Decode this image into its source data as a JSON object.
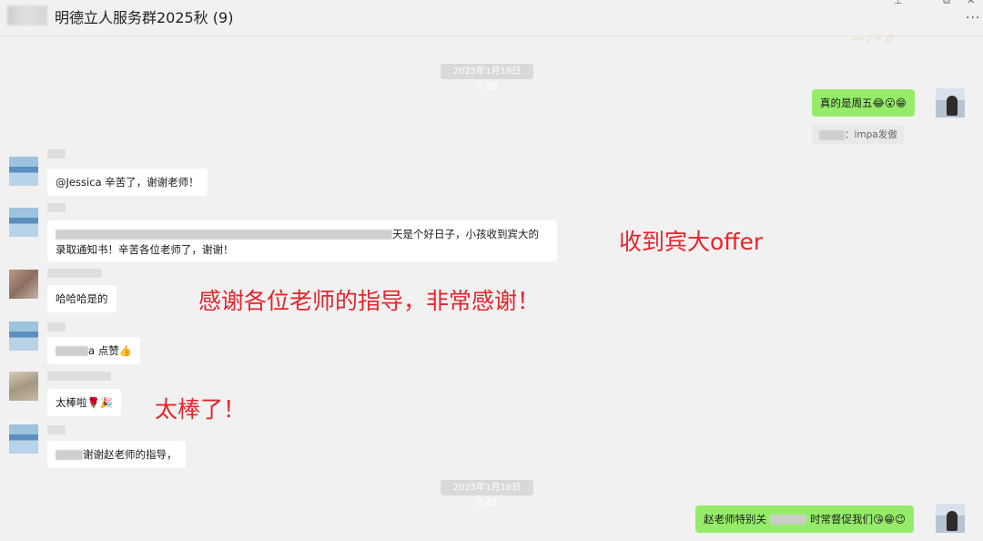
{
  "window": {
    "title": "明德立人服务群2025秋 (9)",
    "pin_icon": "pin-icon",
    "min_icon": "minimize-icon",
    "max_icon": "maximize-icon",
    "close_icon": "close-icon",
    "more_icon": "more-icon"
  },
  "timestamps": [
    "2025年1月18日 7:28",
    "2025年1月18日 7:45"
  ],
  "messages": [
    {
      "side": "right",
      "text": "真的是周五😂😮😁"
    },
    {
      "type": "recall",
      "text": "：impa发傲"
    },
    {
      "side": "left",
      "text": "@Jessica 辛苦了，谢谢老师！"
    },
    {
      "side": "left",
      "line1_tail": "天是个好日子，小孩收到宾大的",
      "line2": "录取通知书！辛苦各位老师了，谢谢！"
    },
    {
      "side": "left",
      "text": "哈哈哈是的"
    },
    {
      "side": "left",
      "text": "a 点赞👍"
    },
    {
      "side": "left",
      "text": "太棒啦🌹🎉"
    },
    {
      "side": "left",
      "text": "谢谢赵老师的指导，"
    },
    {
      "side": "right",
      "head": "赵老师特别关",
      "tail": "时常督促我们😘😁😉"
    }
  ],
  "annotations": [
    "收到宾大offer",
    "感谢各位老师的指导，非常感谢！",
    "太棒了！"
  ],
  "colors": {
    "annotation": "#e8232a",
    "self_bubble": "#95ec69",
    "background": "#f1f1f1"
  }
}
